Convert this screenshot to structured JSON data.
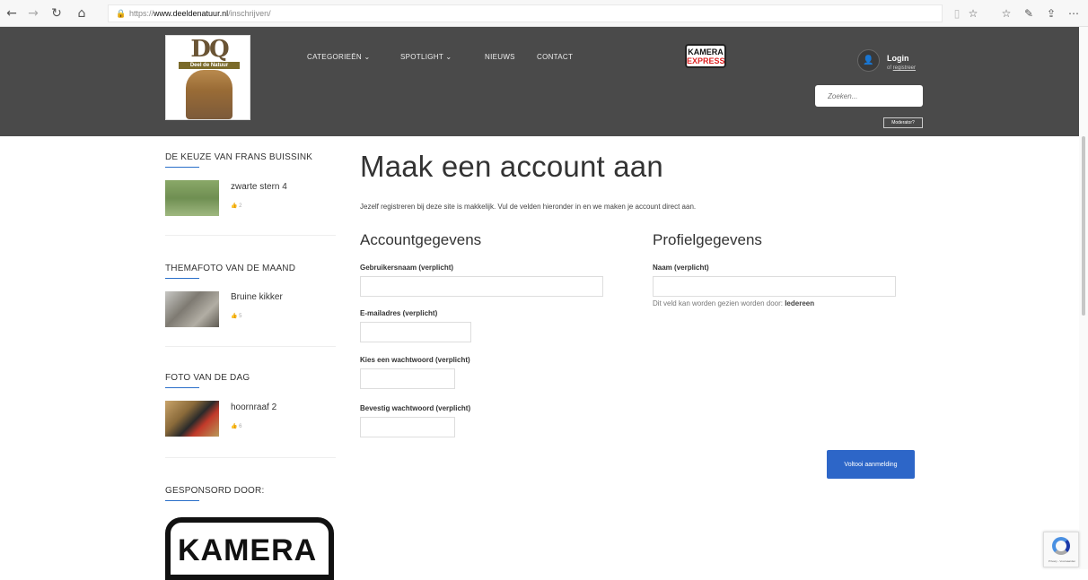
{
  "browser": {
    "url_prefix": "https://",
    "url_domain": "www.deeldenatuur.nl",
    "url_path": "/inschrijven/",
    "back_icon": "←",
    "forward_icon": "→",
    "refresh_icon": "↻",
    "home_icon": "⌂",
    "lock_icon": "🔒",
    "reading_icon": "▯",
    "star_icon": "☆",
    "favorites_icon": "☆",
    "pen_icon": "✎",
    "share_icon": "⇪",
    "more_icon": "⋯"
  },
  "header": {
    "logo_text": "DQ",
    "logo_ribbon": "Deel de Natuur",
    "nav": [
      {
        "label": "CATEGORIEËN ⌄"
      },
      {
        "label": "SPOTLIGHT ⌄"
      },
      {
        "label": "NIEUWS"
      },
      {
        "label": "CONTACT"
      }
    ],
    "sponsor_line1": "KAMERA",
    "sponsor_line2": "EXPRESS",
    "login_label": "Login",
    "register_prefix": "of ",
    "register_link": "registreer",
    "search_placeholder": "Zoeken...",
    "moderator_label": "Moderator?",
    "avatar_icon": "👤"
  },
  "sidebar": {
    "sections": [
      {
        "title": "DE KEUZE VAN FRANS BUISSINK",
        "item_title": "zwarte stern 4",
        "likes": "2"
      },
      {
        "title": "THEMAFOTO VAN DE MAAND",
        "item_title": "Bruine kikker",
        "likes": "5"
      },
      {
        "title": "FOTO VAN DE DAG",
        "item_title": "hoornraaf 2",
        "likes": "6"
      },
      {
        "title": "GESPONSORD DOOR:"
      }
    ],
    "like_icon": "👍",
    "sponsor_big": "KAMERA"
  },
  "main": {
    "title": "Maak een account aan",
    "intro": "Jezelf registreren bij deze site is makkelijk. Vul de velden hieronder in en we maken je account direct aan.",
    "account_heading": "Accountgegevens",
    "profile_heading": "Profielgegevens",
    "username_label": "Gebruikersnaam (verplicht)",
    "email_label": "E-mailadres (verplicht)",
    "password_label": "Kies een wachtwoord (verplicht)",
    "confirm_label": "Bevestig wachtwoord (verplicht)",
    "name_label": "Naam (verplicht)",
    "visibility_prefix": "Dit veld kan worden gezien worden door: ",
    "visibility_value": "Iedereen",
    "submit_label": "Voltooi aanmelding"
  },
  "recaptcha": {
    "text": "Privacy - Voorwaarden"
  }
}
